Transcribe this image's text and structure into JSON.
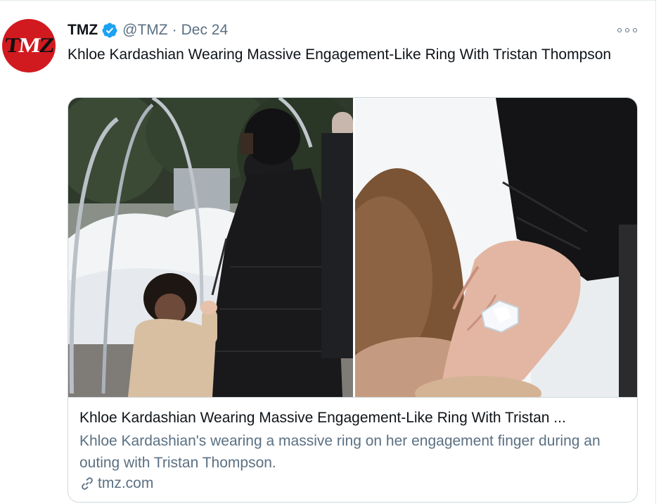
{
  "tweet": {
    "author_name": "TMZ",
    "handle": "@TMZ",
    "separator": "·",
    "date": "Dec 24",
    "text": "Khloe Kardashian Wearing Massive Engagement-Like Ring With Tristan Thompson",
    "avatar_logo": "TMZ",
    "verified_icon": "verified-badge-icon",
    "more_icon": "more-options-icon"
  },
  "card": {
    "title": "Khloe Kardashian Wearing Massive Engagement-Like Ring With Tristan ...",
    "description": "Khloe Kardashian's wearing a massive ring on her engagement finger during an outing with Tristan Thompson.",
    "domain": "tmz.com",
    "link_icon": "link-icon"
  },
  "colors": {
    "verified_blue": "#1da1f2",
    "avatar_red": "#d11a1f",
    "secondary_text": "#5b7083",
    "border": "#cfd9de"
  }
}
